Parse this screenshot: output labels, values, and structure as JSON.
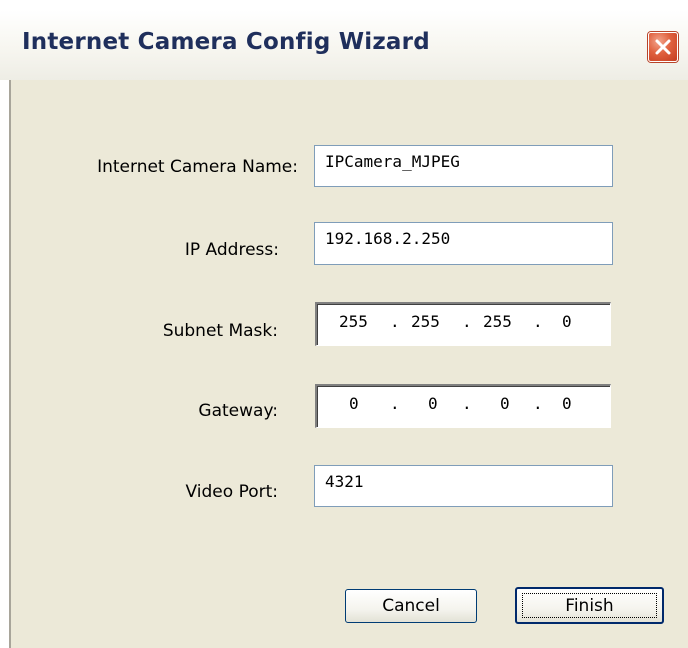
{
  "window": {
    "title": "Internet Camera Config Wizard"
  },
  "form": {
    "camera_name": {
      "label": "Internet Camera Name:",
      "value": "IPCamera_MJPEG"
    },
    "ip_address": {
      "label": "IP Address:",
      "value": "192.168.2.250"
    },
    "subnet_mask": {
      "label": "Subnet Mask:",
      "octets": [
        "255",
        "255",
        "255",
        "0"
      ]
    },
    "gateway": {
      "label": "Gateway:",
      "octets": [
        "0",
        "0",
        "0",
        "0"
      ]
    },
    "video_port": {
      "label": "Video Port:",
      "value": "4321"
    },
    "ip_separator": "."
  },
  "buttons": {
    "cancel_label": "Cancel",
    "finish_label": "Finish"
  },
  "icons": {
    "close": "close-icon"
  },
  "colors": {
    "title_text": "#1f2f5c",
    "dialog_face": "#ece9d8",
    "close_button": "#e0613f",
    "field_border": "#7f9db9",
    "button_border": "#003c74"
  }
}
